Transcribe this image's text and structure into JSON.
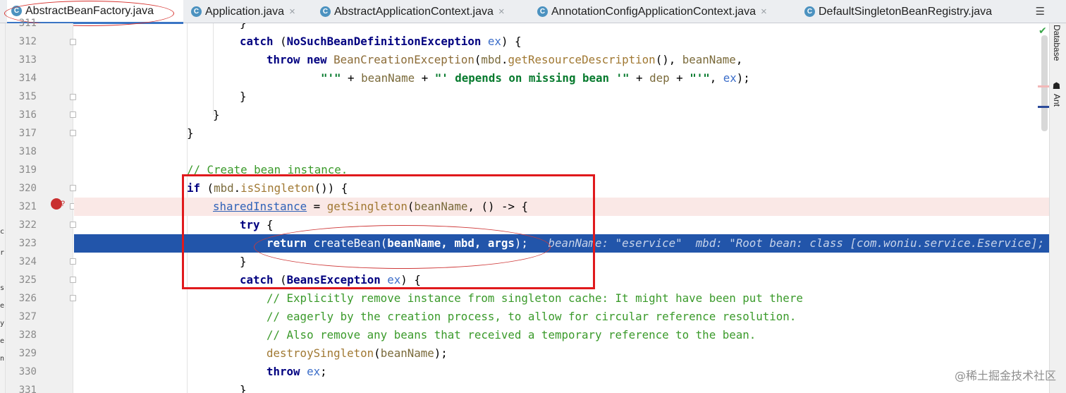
{
  "tabs": [
    {
      "label": "AbstractBeanFactory.java",
      "icon": "class-icon",
      "active": true
    },
    {
      "label": "Application.java",
      "icon": "class-icon"
    },
    {
      "label": "AbstractApplicationContext.java",
      "icon": "class-icon"
    },
    {
      "label": "AnnotationConfigApplicationContext.java",
      "icon": "class-icon"
    },
    {
      "label": "DefaultSingletonBeanRegistry.java",
      "icon": "class-icon"
    }
  ],
  "close_glyph": "×",
  "tab_menu_glyph": "☰",
  "sidebar": {
    "database_label": "Database",
    "ant_label": "Ant"
  },
  "edge_letters": [
    "c",
    "r",
    "s",
    "e",
    "y",
    "e",
    "n"
  ],
  "line_numbers": [
    "311",
    "312",
    "313",
    "314",
    "315",
    "316",
    "317",
    "318",
    "319",
    "320",
    "321",
    "322",
    "323",
    "324",
    "325",
    "326",
    "327",
    "328",
    "329",
    "330",
    "331"
  ],
  "code": {
    "l311": "}",
    "l312_kw": "catch",
    "l312_cls": "NoSuchBeanDefinitionException",
    "l312_var": "ex",
    "l313_kw1": "throw",
    "l313_kw2": "new",
    "l313_ty": "BeanCreationException",
    "l313_a": "mbd",
    "l313_m": "getResourceDescription",
    "l313_b": "beanName",
    "l314_s1": "\"'\"",
    "l314_v1": "beanName",
    "l314_s2": "\"' depends on missing bean '\"",
    "l314_v2": "dep",
    "l314_s3": "\"'\"",
    "l314_v3": "ex",
    "l319_cmt": "// Create bean instance.",
    "l320_kw": "if",
    "l320_a": "mbd",
    "l320_m": "isSingleton",
    "l321_fld": "sharedInstance",
    "l321_m": "getSingleton",
    "l321_a": "beanName",
    "l322_kw": "try",
    "l323_kw": "return",
    "l323_m": "createBean",
    "l323_args": "beanName, mbd, args",
    "l323_hint": "beanName: \"eservice\"  mbd: \"Root bean: class [com.woniu.service.Eservice]; s",
    "l325_kw": "catch",
    "l325_cls": "BeansException",
    "l325_var": "ex",
    "l326_cmt": "// Explicitly remove instance from singleton cache: It might have been put there",
    "l327_cmt": "// eagerly by the creation process, to allow for circular reference resolution.",
    "l328_cmt": "// Also remove any beans that received a temporary reference to the bean.",
    "l329_m": "destroySingleton",
    "l329_a": "beanName",
    "l330_kw": "throw",
    "l330_var": "ex",
    "l331": "}"
  },
  "watermark": "@稀土掘金技术社区",
  "colors": {
    "current_line": "#2255aa",
    "breakpoint": "#c92f2f",
    "annotation": "#e0191c"
  }
}
